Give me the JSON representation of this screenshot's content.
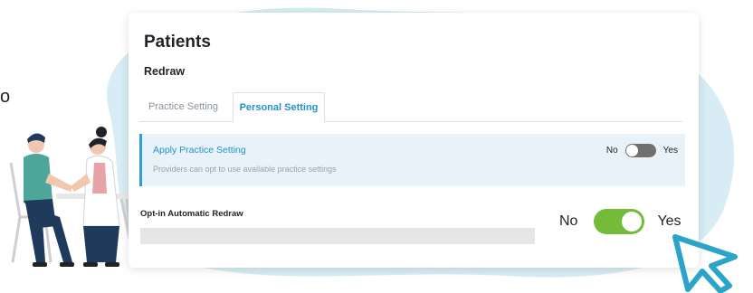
{
  "edge_text": "o",
  "card": {
    "title": "Patients",
    "subtitle": "Redraw",
    "tabs": [
      {
        "label": "Practice Setting",
        "active": false
      },
      {
        "label": "Personal Setting",
        "active": true
      }
    ],
    "banner": {
      "title": "Apply Practice Setting",
      "description": "Providers can opt to use available practice settings",
      "no_label": "No",
      "yes_label": "Yes",
      "toggle_on": false
    },
    "optin": {
      "label": "Opt-in Automatic Redraw",
      "no_label": "No",
      "yes_label": "Yes",
      "toggle_on": true
    }
  },
  "colors": {
    "accent_blue": "#2493c5",
    "toggle_on": "#74bb3a",
    "toggle_off": "#6f6f6f",
    "banner_bg": "#e8f2f8",
    "blob": "#d7ecf4",
    "cursor": "#2aa4c9"
  },
  "icons": {
    "illustration": "doctor-patient-illustration",
    "cursor": "pointer-cursor-icon"
  }
}
